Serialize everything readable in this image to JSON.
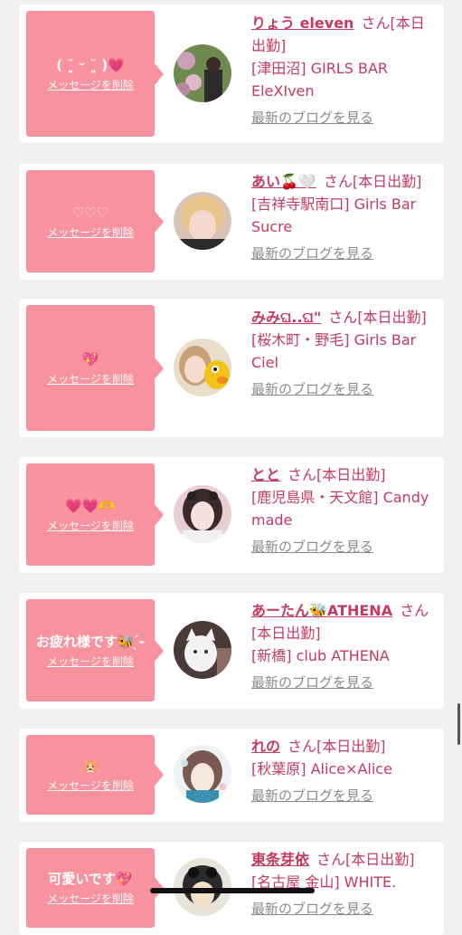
{
  "delete_label": "メッセージを削除",
  "blog_label": "最新のブログを見る",
  "honorific": "さん",
  "status": "[本日出勤]",
  "entries": [
    {
      "message": "( ˘͈ ᵕ ˘͈ )💗",
      "name": "りょう eleven",
      "shop": "[津田沼] GIRLS BAR EleXIven"
    },
    {
      "message": "♡♡♡",
      "name": "あい🍒🤍",
      "shop": "[吉祥寺駅南口] Girls Bar Sucre"
    },
    {
      "message": "💖",
      "name": "みみଘ..ଘ\"",
      "shop": "[桜木町・野毛] Girls Bar Ciel"
    },
    {
      "message": "💗💗🫶",
      "name": "とと",
      "shop": "[鹿児島県・天文館] Candy made"
    },
    {
      "message": "お疲れ様です🐝 ̖́-",
      "name": "あーたん🐝ATHENA",
      "shop": "[新橋] club ATHENA"
    },
    {
      "message": "🐹",
      "name": "れの",
      "shop": "[秋葉原] Alice×Alice"
    },
    {
      "message": "可愛いです💖",
      "name": "東条芽依",
      "shop": "[名古屋 金山] WHITE."
    }
  ]
}
